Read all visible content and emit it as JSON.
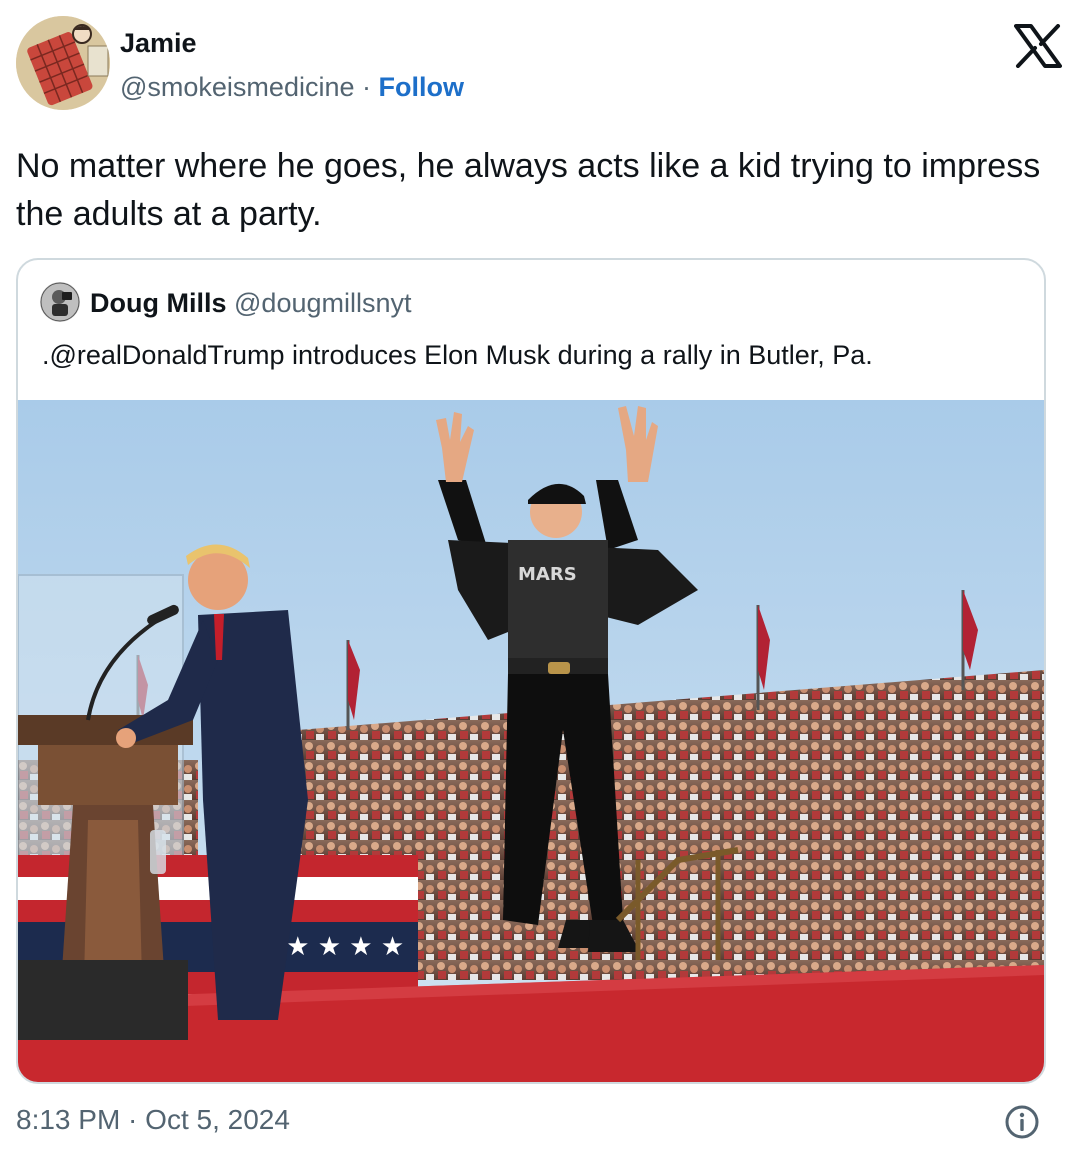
{
  "author": {
    "display_name": "Jamie",
    "handle": "@smokeismedicine",
    "separator": " · ",
    "follow_label": "Follow",
    "avatar_icon": "avatar-illustration-icon"
  },
  "header": {
    "logo_icon": "x-logo-icon"
  },
  "tweet": {
    "text": "No matter where he goes, he always acts like a kid trying to impress the adults at a party."
  },
  "quoted_tweet": {
    "display_name": "Doug Mills",
    "handle": "@dougmillsnyt",
    "text": ".@realDonaldTrump introduces Elon Musk during a rally in Butler, Pa.",
    "shirt_text": "MARS",
    "photo": {
      "subject": "rally-photo",
      "colors": {
        "sky": "#b9d6ef",
        "stage": "#c8282e",
        "crowd": "#6b4a3e"
      }
    }
  },
  "footer": {
    "timestamp": "8:13 PM · Oct 5, 2024",
    "info_icon": "info-icon"
  },
  "colors": {
    "follow": "#1d6fc9",
    "secondary_text": "#536471",
    "border": "#cfd9de"
  }
}
